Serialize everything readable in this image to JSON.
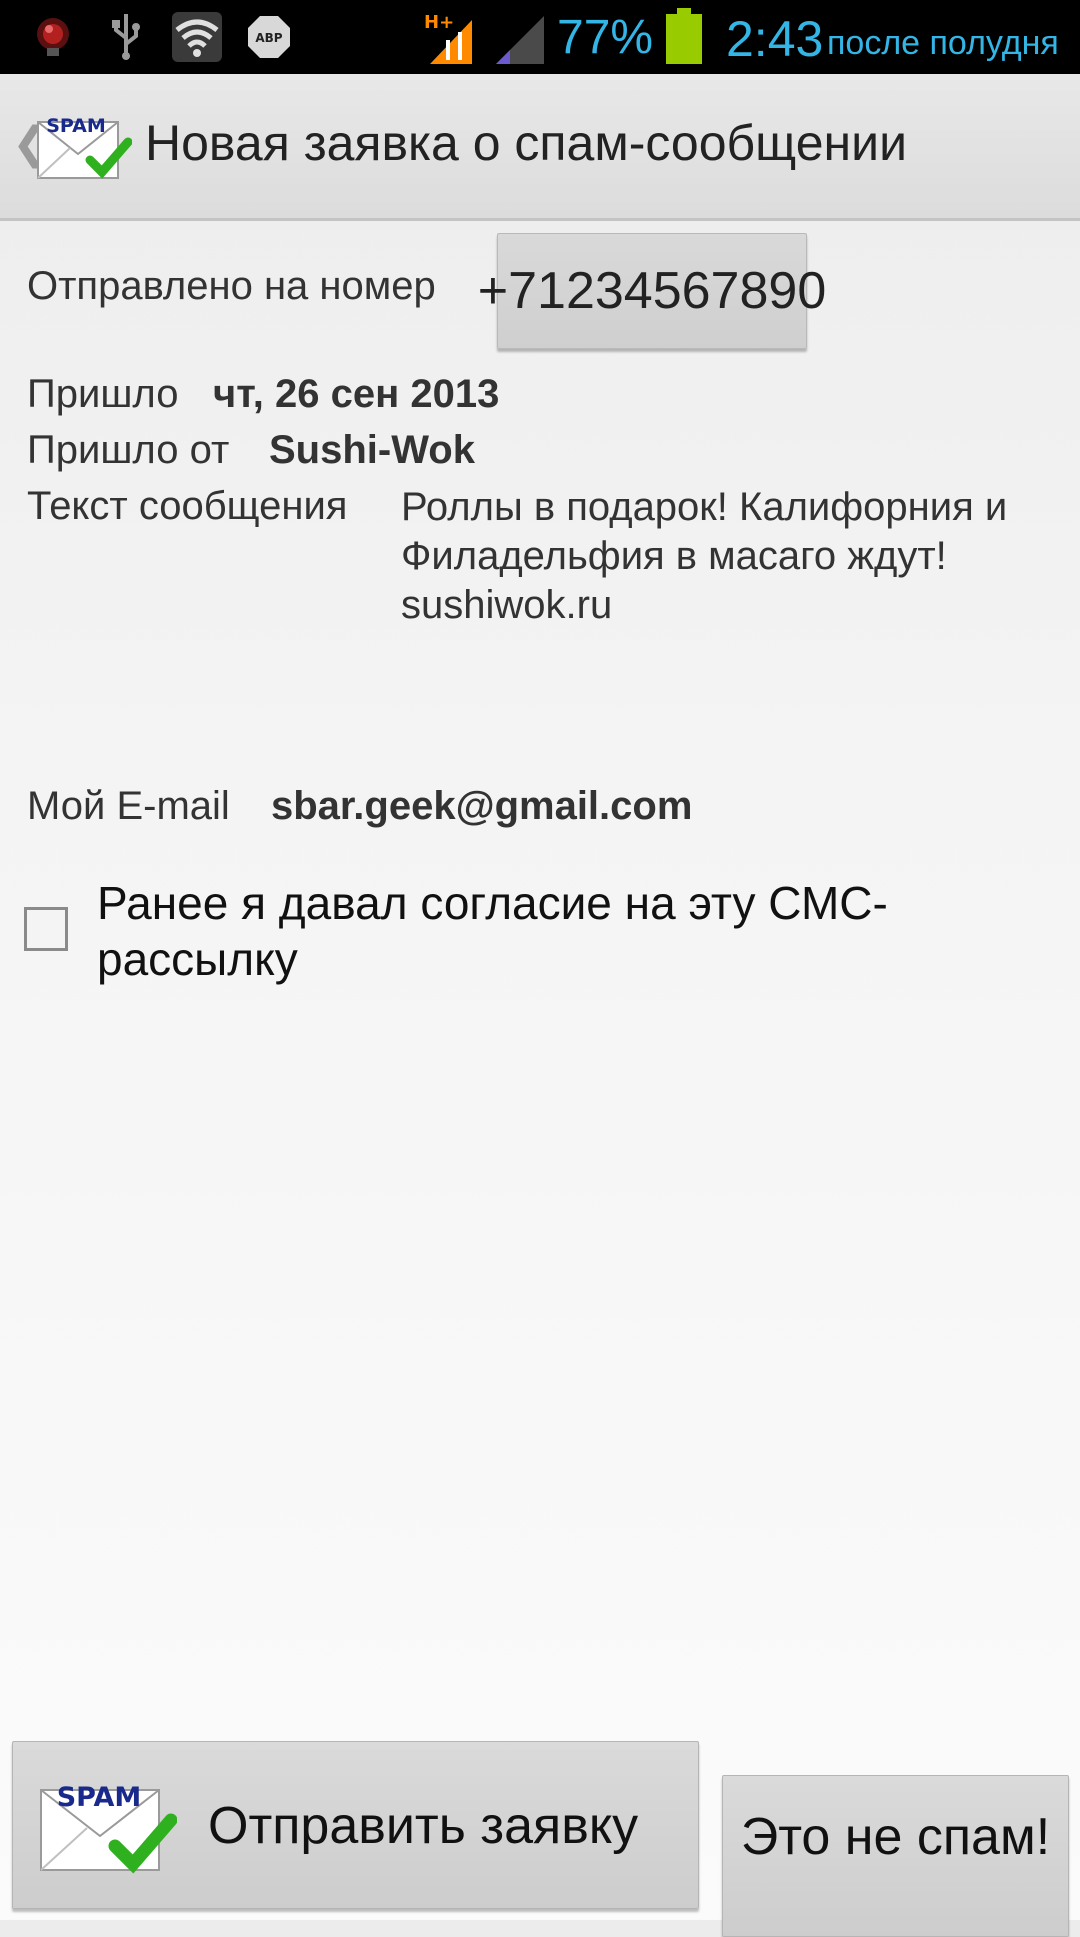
{
  "status_bar": {
    "battery_percent": "77%",
    "time": "2:43",
    "period": "после полудня",
    "network_type": "H+",
    "icons": [
      "notification-icon",
      "usb-icon",
      "wifi-icon",
      "adblock-icon",
      "network-h-plus-icon",
      "signal-icon",
      "battery-icon"
    ],
    "adblock_label": "ABP",
    "accent_color": "#33b5e5"
  },
  "action_bar": {
    "title": "Новая заявка о спам-сообщении",
    "logo_text": "SPAM"
  },
  "form": {
    "sent_to_label": "Отправлено на номер",
    "sent_to_value": "+71234567890",
    "received_label": "Пришло",
    "received_value": "чт, 26 сен 2013",
    "from_label": "Пришло от",
    "from_value": "Sushi-Wok",
    "message_label": "Текст сообщения",
    "message_value": "Роллы в подарок! Калифорния и Филадельфия в масаго ждут! sushiwok.ru",
    "email_label": "Мой E-mail",
    "email_value": "sbar.geek@gmail.com",
    "consent_label": "Ранее я давал согласие на эту СМС-рассылку",
    "consent_checked": false
  },
  "buttons": {
    "send_label": "Отправить заявку",
    "send_logo_text": "SPAM",
    "not_spam_label": "Это не спам!"
  }
}
